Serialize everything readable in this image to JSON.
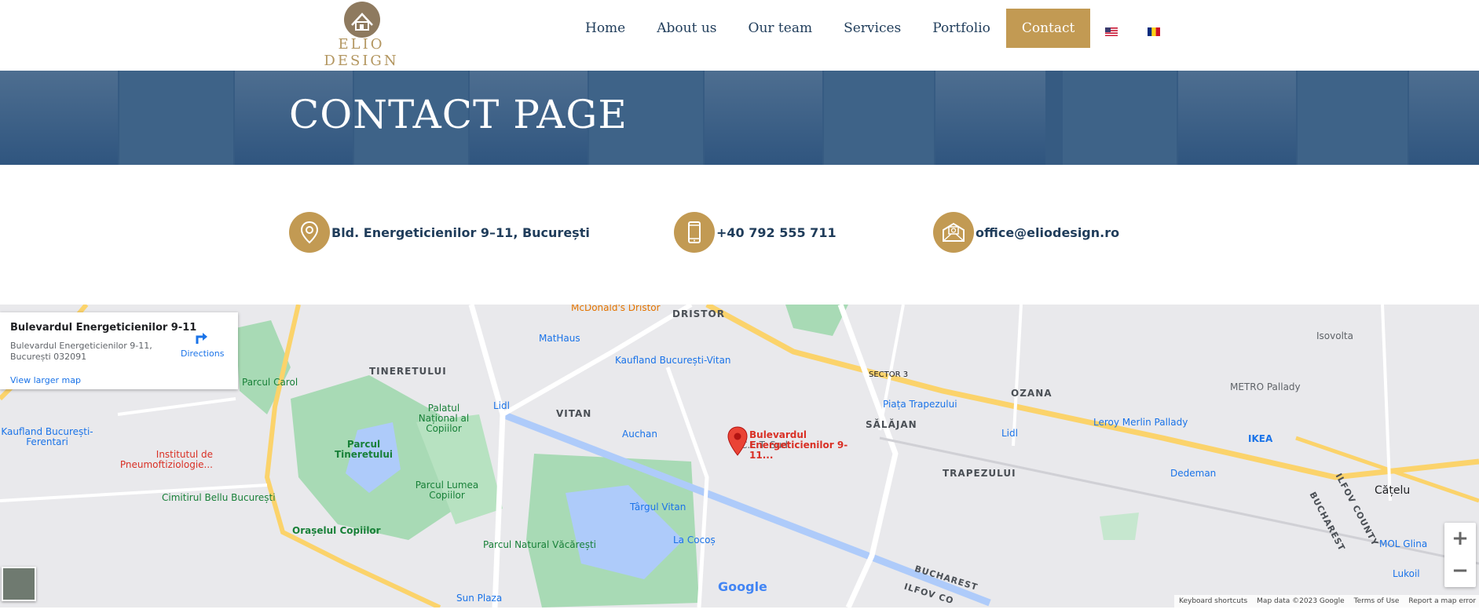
{
  "brand": {
    "logo_text": "ELIO DESIGN"
  },
  "nav": {
    "items": [
      "Home",
      "About us",
      "Our team",
      "Services",
      "Portfolio",
      "Contact"
    ],
    "active": "Contact"
  },
  "banner": {
    "title": "CONTACT PAGE"
  },
  "contact": {
    "address": "Bld. Energeticienilor 9–11, București",
    "phone": "+40 792 555 711",
    "email": "office@eliodesign.ro"
  },
  "map": {
    "card": {
      "title": "Bulevardul Energeticienilor 9-11",
      "address": "Bulevardul Energeticienilor 9-11, București 032091",
      "directions": "Directions",
      "larger": "View larger map"
    },
    "pin_label": "Bulevardul Energeticienilor 9-11...",
    "labels": {
      "dristor": "DRISTOR",
      "mcdonalds": "McDonald's Dristor",
      "tineretului": "TINERETULUI",
      "vitan": "VITAN",
      "mathaus": "MatHaus",
      "kaufland_vitan": "Kaufland București-Vitan",
      "parcul_carol": "Parcul Carol",
      "palatul": "Palatul Național al Copiilor",
      "lidl1": "Lidl",
      "auchan": "Auchan",
      "kaufland_ferentari": "Kaufland București-Ferentari",
      "institutul": "Institutul de Pneumoftiziologie...",
      "parcul_tineretului": "Parcul Tineretului",
      "cimitirul": "Cimitirul Bellu București",
      "parcul_lumea": "Parcul Lumea Copiilor",
      "orasul": "Orașelul Copiilor",
      "targul": "Târgul Vitan",
      "parcul_natural": "Parcul Natural Văcărești",
      "la_cocos": "La Cocoș",
      "sun_plaza": "Sun Plaza",
      "cet_sud": "C.E.T. Sud",
      "salajan": "SĂLĂJAN",
      "sector3": "SECTOR 3",
      "ozana": "OZANA",
      "piata": "Piața Trapezului",
      "lidl2": "Lidl",
      "trapezului": "TRAPEZULUI",
      "isovolta": "Isovolta",
      "metro": "METRO Pallady",
      "leroy": "Leroy Merlin Pallady",
      "ikea": "IKEA",
      "dedeman": "Dedeman",
      "catelu": "Cățelu",
      "mol": "MOL Glina",
      "lukoil": "Lukoil",
      "ilfov_county": "ILFOV COUNTY",
      "bucharest_v": "BUCHAREST",
      "bucharest_b": "BUCHAREST",
      "ilfov_b": "ILFOV CO"
    },
    "zoom_in": "+",
    "zoom_out": "−",
    "google": "Google",
    "attribution": [
      "Keyboard shortcuts",
      "Map data ©2023 Google",
      "Terms of Use",
      "Report a map error"
    ]
  },
  "colors": {
    "gold": "#c29a53",
    "navy": "#1f3c5a",
    "banner": "#365b82"
  }
}
